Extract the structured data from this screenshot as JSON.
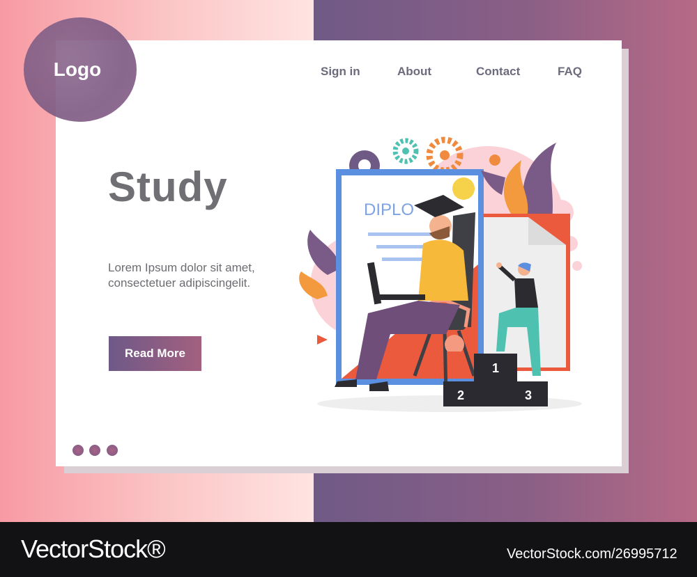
{
  "logo": {
    "text": "Logo"
  },
  "nav": {
    "items": [
      "Sign in",
      "About",
      "Contact",
      "FAQ"
    ]
  },
  "hero": {
    "title": "Study",
    "body_lines": [
      "Lorem Ipsum dolor sit amet,",
      "consectetuer adipiscingelit."
    ],
    "cta_label": "Read More"
  },
  "illustration": {
    "diploma_text": "DIPLO",
    "podium_labels": [
      "1",
      "2",
      "3"
    ]
  },
  "pagination": {
    "dot_count": 3
  },
  "watermark": {
    "left": "VectorStock®",
    "right": "VectorStock.com/26995712"
  },
  "colors": {
    "accent_purple": "#7e5a86",
    "accent_pink": "#b66a86",
    "text_gray": "#6f6f74"
  }
}
